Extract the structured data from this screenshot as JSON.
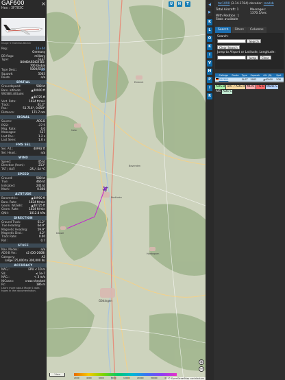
{
  "aircraft": {
    "callsign": "GAF600",
    "hex_label": "Hex :",
    "hex": "3F783C",
    "photo_credit": "Image © Matthias Becker",
    "registration_k": "Reg.:",
    "registration": "14+04",
    "country_k": "",
    "country": "Germany",
    "db_flags_k": "DB flags:",
    "db_flags": "military",
    "type_k": "Type:",
    "type": "GLST",
    "model_k": "",
    "model": "BOMBARDIER BD-700 Global 5000/5500",
    "type_desc_k": "Type Desc.:",
    "type_desc": "L2J",
    "squawk_k": "Squawk:",
    "squawk": "5003",
    "route_k": "Route:",
    "route": "n/a"
  },
  "sections": {
    "spatial": "SPATIAL",
    "signal": "SIGNAL",
    "fms": "FMS SEL",
    "wind": "WIND",
    "speed": "SPEED",
    "altitude": "ALTITUDE",
    "direction": "DIRECTION",
    "stuff": "STUFF",
    "accuracy": "ACCURACY"
  },
  "spatial": [
    {
      "k": "Groundspeed:",
      "v": "508 kt"
    },
    {
      "k": "Baro. altitude:",
      "v": "▲40900 ft"
    },
    {
      "k": "WGS84 altitude:",
      "v": ""
    },
    {
      "k": "",
      "v": "▲40725 ft"
    },
    {
      "k": "Vert. Rate:",
      "v": "1024 ft/min"
    },
    {
      "k": "Track:",
      "v": "61.2°"
    },
    {
      "k": "Pos.:",
      "v": "51.716°, 9.859°"
    },
    {
      "k": "Distance:",
      "v": "171.7 nm"
    }
  ],
  "signal": [
    {
      "k": "Source:",
      "v": "ADS-B"
    },
    {
      "k": "RSSI:",
      "v": "-27.5"
    },
    {
      "k": "Msg. Rate:",
      "v": "6.0"
    },
    {
      "k": "Messages:",
      "v": "527"
    },
    {
      "k": "Last Pos.:",
      "v": "1.2 s"
    },
    {
      "k": "Last Seen:",
      "v": "1.0 s"
    }
  ],
  "fms": [
    {
      "k": "Sel. Alt.:",
      "v": "40992 ft"
    },
    {
      "k": "Sel. Head.:",
      "v": "n/a"
    }
  ],
  "wind": [
    {
      "k": "Speed:",
      "v": "45 kt"
    },
    {
      "k": "Direction (from):",
      "v": "213°"
    },
    {
      "k": "TAT / OAT:",
      "v": "-25 / -54 °C"
    }
  ],
  "speed": [
    {
      "k": "Ground:",
      "v": "508 kt"
    },
    {
      "k": "True:",
      "v": "466 kt"
    },
    {
      "k": "Indicated:",
      "v": "241 kt"
    },
    {
      "k": "Mach:",
      "v": "0.808"
    }
  ],
  "altitude": [
    {
      "k": "Barometric:",
      "v": "▲40900 ft"
    },
    {
      "k": "Baro. Rate:",
      "v": "1024 ft/min"
    },
    {
      "k": "Geom. WGS84:",
      "v": "▲40725 ft"
    },
    {
      "k": "Geom. Rate:",
      "v": "1024 ft/min"
    },
    {
      "k": "QNH:",
      "v": "1012.8 hPa"
    }
  ],
  "direction": [
    {
      "k": "Ground Track:",
      "v": "61.2°"
    },
    {
      "k": "True Heading:",
      "v": "64.9°"
    },
    {
      "k": "Magnetic Heading:",
      "v": "59.9°"
    },
    {
      "k": "Magnetic Decl.:",
      "v": "4.2°"
    },
    {
      "k": "Track Rate:",
      "v": "0.00"
    },
    {
      "k": "Roll:",
      "v": "0.7"
    }
  ],
  "stuff": [
    {
      "k": "Nav. Modes:",
      "v": "n/a"
    },
    {
      "k": "ADS-B Ver.:",
      "v": "v2 (DO-260B)"
    },
    {
      "k": "Category:",
      "v": "A3"
    },
    {
      "k": "",
      "v": "Large (75,000 to 300,000 lb)"
    }
  ],
  "accuracy": [
    {
      "k": "NACₚ:",
      "v": "EPU < 10 m"
    },
    {
      "k": "SIL:",
      "v": "≤ 1e-7"
    },
    {
      "k": "NACᵥ:",
      "v": "< 3 m/s"
    },
    {
      "k": "NICʙᴀʀᴏ:",
      "v": "cross-checked"
    },
    {
      "k": "Rc:",
      "v": "186 m"
    }
  ],
  "left_footer": "Learn more about Mode S data types in the documentation.",
  "map": {
    "buttons": [
      "U",
      "H",
      "T"
    ],
    "scale_label": "1 km",
    "attribution": "© OpenStreetMap contributors",
    "colorbar_ticks": [
      "2000",
      "4000",
      "6000",
      "8000",
      "10000",
      "20000",
      "30000",
      "40000+"
    ],
    "places": [
      "Göttingen",
      "Northeim",
      "Uslar",
      "Einbeck",
      "Dassel",
      "Hardegsen",
      "Bovenden"
    ],
    "zoom_in": "+",
    "zoom_out": "−"
  },
  "strip_buttons": [
    "◀",
    "▶",
    "K",
    "L",
    "O",
    "K",
    "I",
    "V",
    "M",
    "P",
    "I",
    "R"
  ],
  "panel": {
    "version_link": "tar1090",
    "version": "(3.14.1784)",
    "decoder_label": "decoder:",
    "decoder_link": "readsb",
    "total_label": "Total Aircraft:",
    "total": "1",
    "messages_label": "Messages:",
    "messages": "1370.5/sec",
    "with_pos_label": "With Position:",
    "with_pos": "1",
    "stats": "Stats available",
    "tabs": [
      "Search",
      "Filters",
      "Columns"
    ],
    "search_label": "Search:",
    "search_btn": "Search",
    "clear_search": "Clear Search",
    "jump_label": "Jump to Airport or Latitude, Longitude:",
    "jump_btn": "Jump",
    "clear_btn": "Clear"
  },
  "table": {
    "headers": [
      "Callsign",
      "Route",
      "Type",
      "Squawk",
      "Alt. (ft)",
      "Spd."
    ],
    "rows": [
      [
        "GAF600",
        "",
        "GLST",
        "5003",
        "▲40900",
        "508"
      ]
    ]
  },
  "legend": [
    {
      "label": "ADS-B",
      "bg": "#a8f0a8",
      "fg": "#111"
    },
    {
      "label": "UAT / ADS-R",
      "bg": "#f5d7a0",
      "fg": "#111"
    },
    {
      "label": "MLAT",
      "bg": "#ffb0b0",
      "fg": "#111"
    },
    {
      "label": "TIS-B",
      "bg": "#ff6b6b",
      "fg": "#111"
    },
    {
      "label": "Mode-S",
      "bg": "#b8d4ff",
      "fg": "#111"
    },
    {
      "label": "AIS",
      "bg": "#2f2f2f",
      "fg": "#eee"
    },
    {
      "label": "ADS-C",
      "bg": "#bfe6d0",
      "fg": "#111"
    }
  ]
}
